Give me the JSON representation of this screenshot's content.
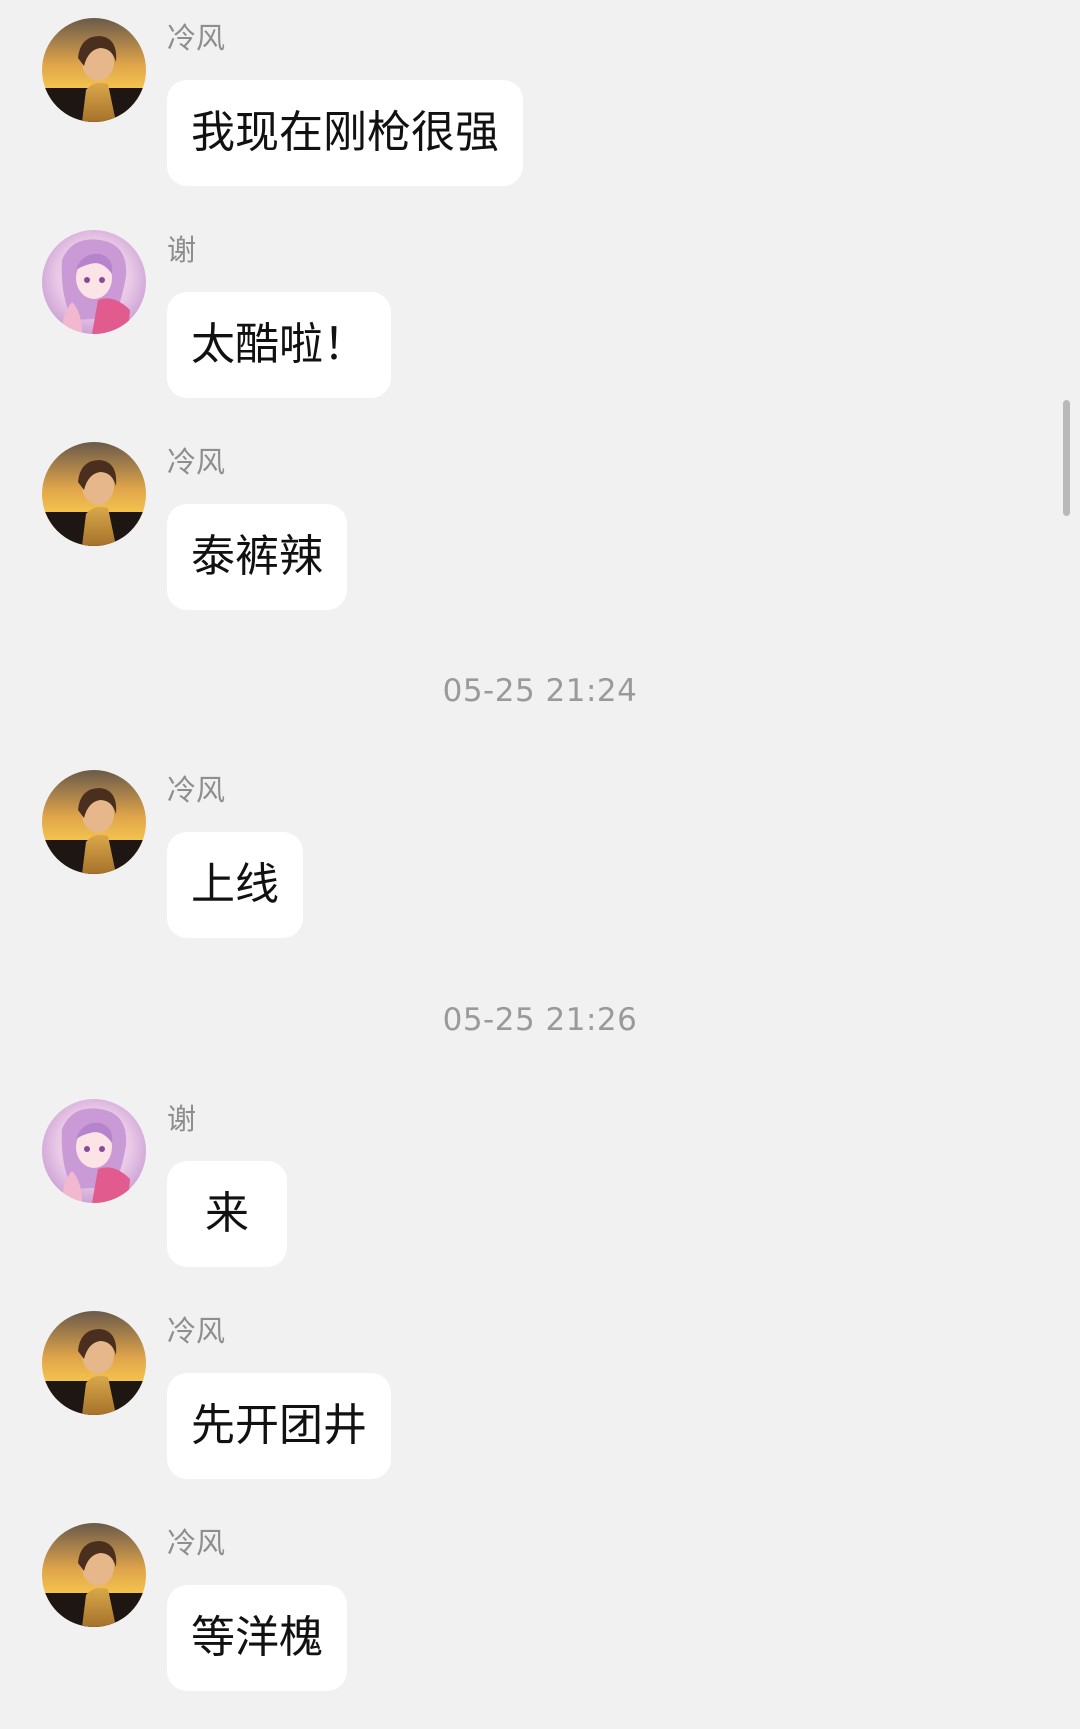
{
  "colors": {
    "background": "#f1f1f1",
    "bubble": "#ffffff",
    "sender_name": "#8e8e8e",
    "timestamp": "#9a9a9a"
  },
  "messages": [
    {
      "sender": "冷风",
      "avatar": "boy-sunset-avatar",
      "text": "我现在刚枪很强"
    },
    {
      "sender": "谢",
      "avatar": "anime-girl-pink-avatar",
      "text": "太酷啦！"
    },
    {
      "sender": "冷风",
      "avatar": "boy-sunset-avatar",
      "text": "泰裤辣"
    },
    {
      "sender": "冷风",
      "avatar": "boy-sunset-avatar",
      "text": "上线"
    },
    {
      "sender": "谢",
      "avatar": "anime-girl-pink-avatar",
      "text": " 来 "
    },
    {
      "sender": "冷风",
      "avatar": "boy-sunset-avatar",
      "text": "先开团井"
    },
    {
      "sender": "冷风",
      "avatar": "boy-sunset-avatar",
      "text": "等洋槐"
    }
  ],
  "timestamps": [
    "05-25 21:24",
    "05-25 21:26"
  ]
}
